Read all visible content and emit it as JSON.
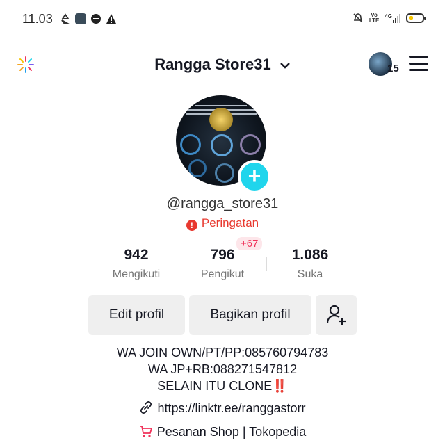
{
  "status_bar": {
    "time": "11.03",
    "signal_label": "4G",
    "volte_top": "Vo",
    "volte_bottom": "LTE",
    "battery_level": 0.35,
    "battery_color": "#f5c400"
  },
  "header": {
    "title": "Rangga Store31",
    "account_badge_count": "15"
  },
  "profile": {
    "username": "@rangga_store31",
    "warning_text": "Peringatan",
    "warning_color": "#e8392f",
    "add_button_color": "#20d5ec"
  },
  "stats": {
    "following": {
      "value": "942",
      "label": "Mengikuti"
    },
    "followers": {
      "value": "796",
      "label": "Pengikut",
      "delta": "+67"
    },
    "likes": {
      "value": "1.086",
      "label": "Suka"
    }
  },
  "buttons": {
    "edit_profile": "Edit profil",
    "share_profile": "Bagikan profil"
  },
  "bio": {
    "line1": "WA JOIN OWN/PT/PP:085760794783",
    "line2": "WA JP+RB:088271547812",
    "line3": "SELAIN ITU CLONE",
    "line3_emoji": "‼️"
  },
  "link": {
    "text": "https://linktr.ee/ranggastorr"
  },
  "shop": {
    "text": "Pesanan Shop | Tokopedia",
    "icon_color": "#f0325a"
  }
}
